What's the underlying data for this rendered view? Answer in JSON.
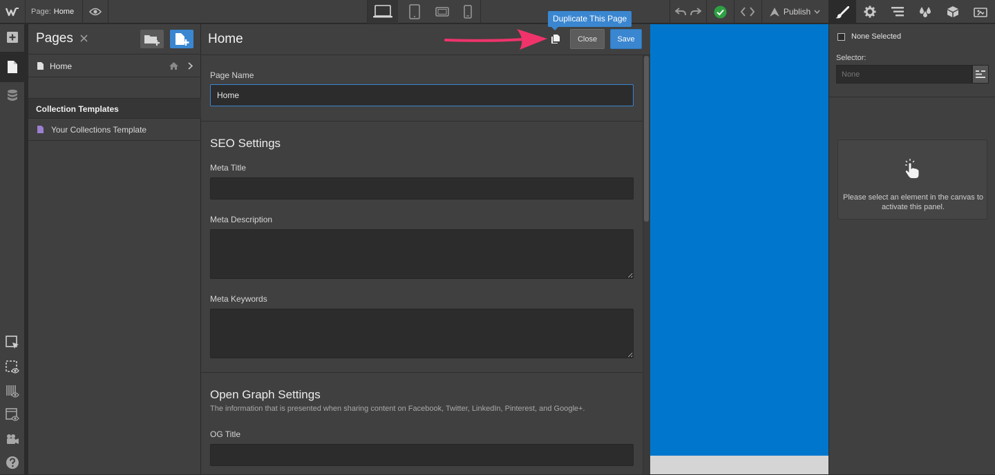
{
  "topbar": {
    "page_label": "Page:",
    "page_value": "Home",
    "publish_label": "Publish"
  },
  "pages_panel": {
    "title": "Pages",
    "pages": [
      {
        "name": "Home"
      }
    ],
    "collection_heading": "Collection Templates",
    "collection_items": [
      {
        "name": "Your Collections Template"
      }
    ]
  },
  "page_settings": {
    "title": "Home",
    "tooltip": "Duplicate This Page",
    "close_label": "Close",
    "save_label": "Save",
    "page_name_label": "Page Name",
    "page_name_value": "Home",
    "seo_title": "SEO Settings",
    "meta_title_label": "Meta Title",
    "meta_description_label": "Meta Description",
    "meta_keywords_label": "Meta Keywords",
    "og_title": "Open Graph Settings",
    "og_description": "The information that is presented when sharing content on Facebook, Twitter, LinkedIn, Pinterest, and Google+.",
    "og_title_label": "OG Title"
  },
  "style_panel": {
    "none_selected": "None Selected",
    "selector_label": "Selector:",
    "selector_placeholder": "None",
    "empty_hint": "Please select an element in the canvas to activate this panel."
  },
  "colors": {
    "accent": "#3a86d0",
    "canvas": "#0077cc",
    "annotation_arrow": "#f0336b",
    "status_ok": "#2ea043"
  },
  "icons": [
    "webflow-logo-icon",
    "eye-icon",
    "desktop-icon",
    "tablet-icon",
    "tablet-landscape-icon",
    "phone-icon",
    "undo-icon",
    "redo-icon",
    "check-circle-icon",
    "code-icon",
    "publish-icon",
    "chevron-down-icon",
    "brush-icon",
    "gear-icon",
    "navigator-icon",
    "swatch-icon",
    "box-icon",
    "interactions-icon",
    "plus-icon",
    "page-icon",
    "database-icon",
    "select-icon",
    "visibility-icon",
    "grid-icon",
    "layout-icon",
    "video-icon",
    "help-icon",
    "close-icon",
    "add-folder-icon",
    "add-page-icon",
    "home-icon",
    "chevron-right-icon",
    "duplicate-icon",
    "menu-icon",
    "hand-pointer-icon"
  ]
}
